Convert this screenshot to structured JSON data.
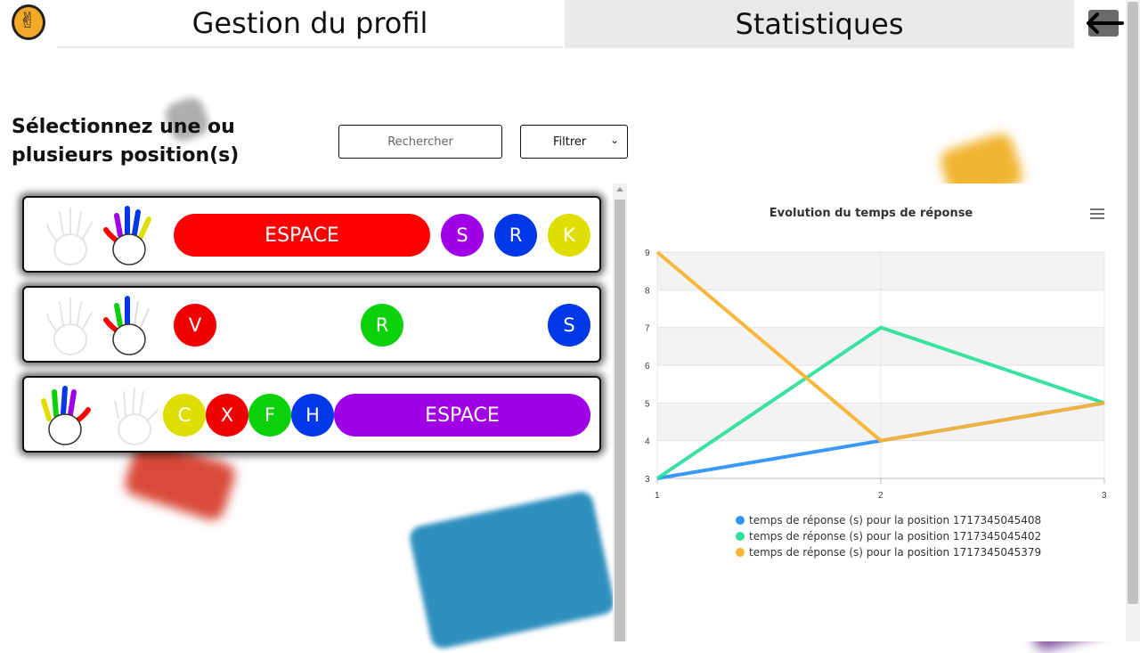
{
  "header": {
    "tab_profile": "Gestion du profil",
    "tab_stats": "Statistiques"
  },
  "selection": {
    "title": "Sélectionnez une ou plusieurs position(s)",
    "search_placeholder": "Rechercher",
    "filter_selected": "Filtrer"
  },
  "positions": [
    {
      "active_hand": "right",
      "keys": [
        {
          "label": "ESPACE",
          "color": "#ff0000",
          "shape": "pill"
        },
        {
          "label": "S",
          "color": "#a000e6",
          "shape": "circle"
        },
        {
          "label": "R",
          "color": "#0037e6",
          "shape": "circle"
        },
        {
          "label": "K",
          "color": "#dede00",
          "shape": "circle"
        }
      ]
    },
    {
      "active_hand": "right",
      "keys": [
        {
          "label": "V",
          "color": "#f00000",
          "shape": "circle"
        },
        {
          "label": "R",
          "color": "#0bd10b",
          "shape": "circle"
        },
        {
          "label": "S",
          "color": "#0037e6",
          "shape": "circle"
        }
      ]
    },
    {
      "active_hand": "left",
      "keys": [
        {
          "label": "C",
          "color": "#dede00",
          "shape": "circle"
        },
        {
          "label": "X",
          "color": "#f00000",
          "shape": "circle"
        },
        {
          "label": "F",
          "color": "#0bd10b",
          "shape": "circle"
        },
        {
          "label": "H",
          "color": "#0037e6",
          "shape": "circle"
        },
        {
          "label": "ESPACE",
          "color": "#a000e6",
          "shape": "pill"
        }
      ]
    }
  ],
  "chart_data": {
    "type": "line",
    "title": "Evolution du temps de réponse",
    "x": [
      1,
      2,
      3
    ],
    "xlim": [
      1,
      3
    ],
    "ylim": [
      3,
      9
    ],
    "yticks": [
      3,
      4,
      5,
      6,
      7,
      8,
      9
    ],
    "grid": true,
    "legend_position": "bottom",
    "series": [
      {
        "name": "temps de réponse (s) pour la position 1717345045408",
        "values": [
          3,
          4,
          5
        ],
        "color": "#2e93fa"
      },
      {
        "name": "temps de réponse (s) pour la position 1717345045402",
        "values": [
          3,
          7,
          5
        ],
        "color": "#2ee09c"
      },
      {
        "name": "temps de réponse (s) pour la position 1717345045379",
        "values": [
          9,
          4,
          5
        ],
        "color": "#f9b433"
      }
    ]
  }
}
